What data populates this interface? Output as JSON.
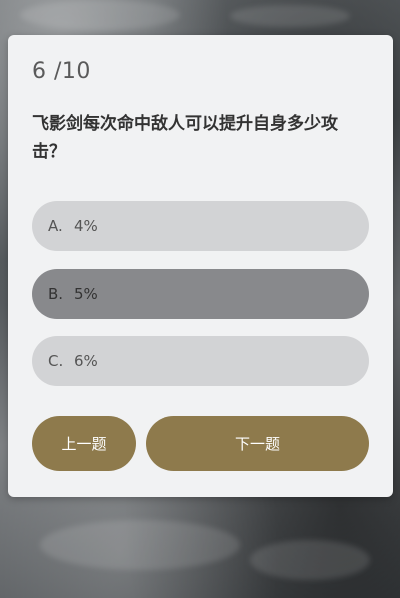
{
  "quiz": {
    "progress": "6 /10",
    "question": "飞影剑每次命中敌人可以提升自身多少攻击？",
    "options": [
      {
        "letter": "A.",
        "text": "4%"
      },
      {
        "letter": "B.",
        "text": "5%"
      },
      {
        "letter": "C.",
        "text": "6%"
      }
    ],
    "selected_option": "B",
    "prev_label": "上一题",
    "next_label": "下一题"
  },
  "colors": {
    "card_bg": "#f1f2f3",
    "option_bg": "#d2d3d5",
    "option_selected_bg": "#88898c",
    "button_bg": "#8e7a4c"
  }
}
